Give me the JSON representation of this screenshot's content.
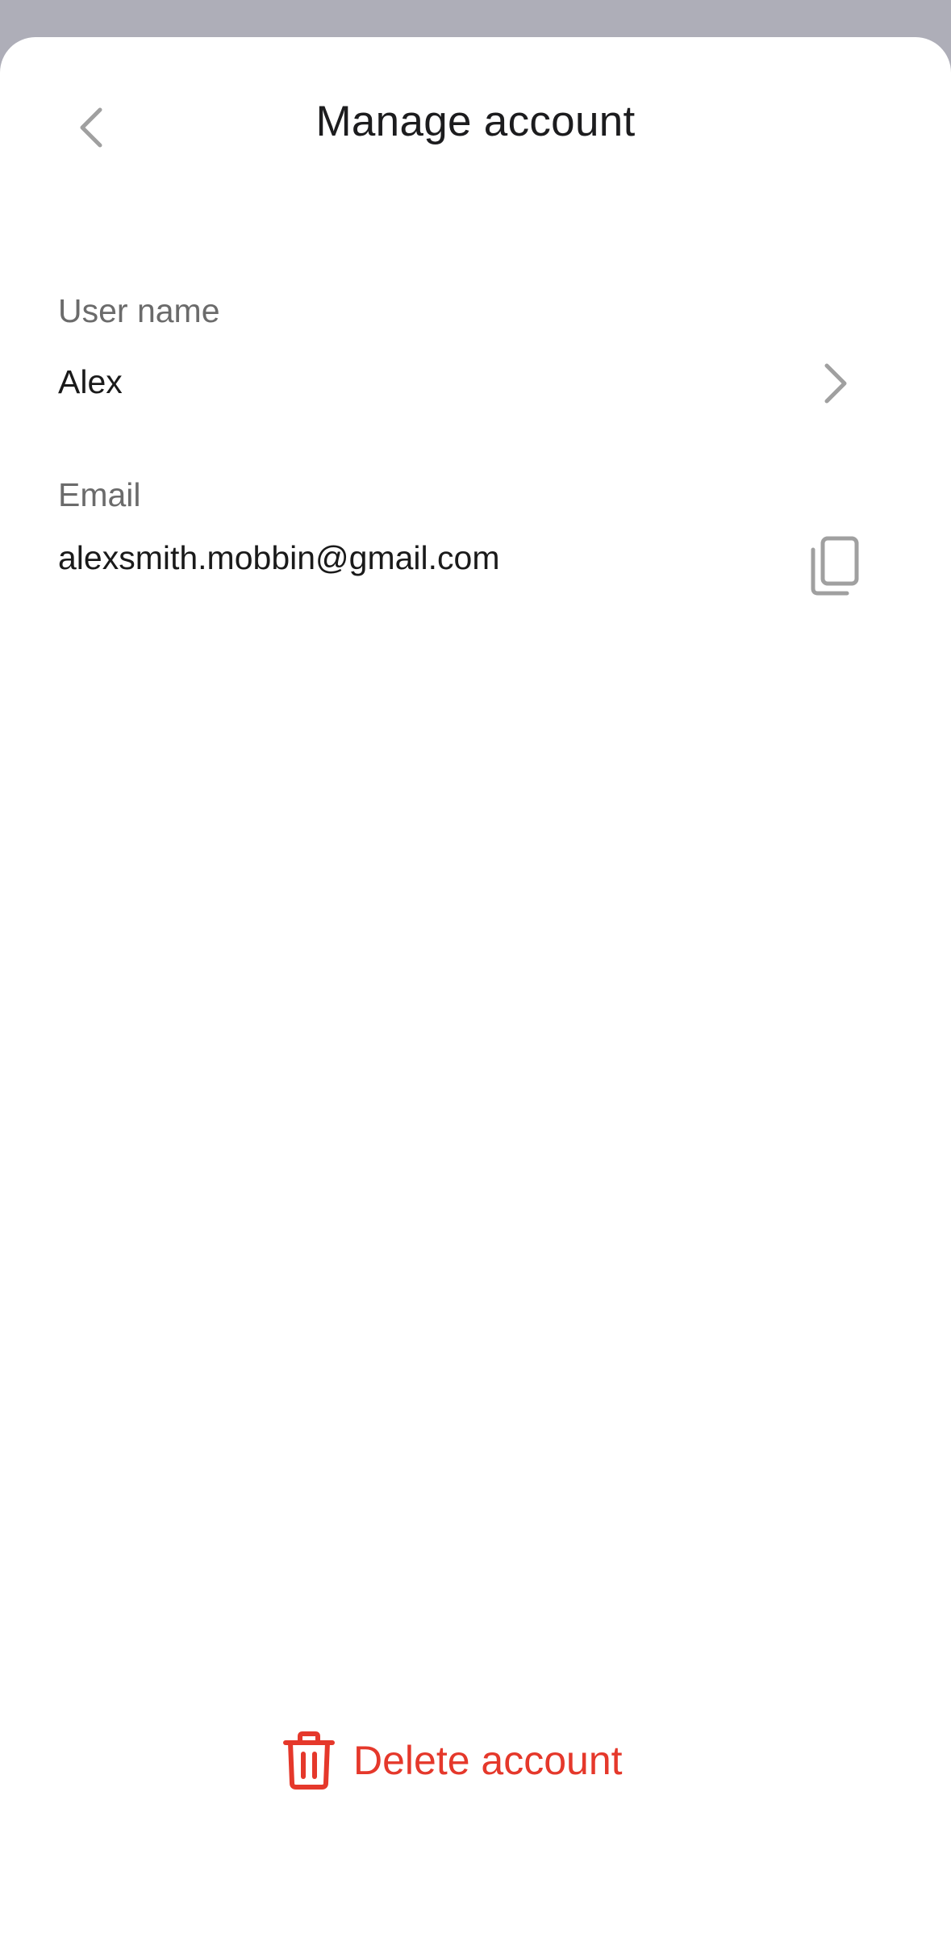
{
  "header": {
    "title": "Manage account"
  },
  "fields": {
    "username": {
      "label": "User name",
      "value": "Alex"
    },
    "email": {
      "label": "Email",
      "value": "alexsmith.mobbin@gmail.com"
    }
  },
  "actions": {
    "delete_label": "Delete account"
  },
  "icons": {
    "back": "chevron-left-icon",
    "username_action": "chevron-right-icon",
    "email_action": "copy-icon",
    "delete": "trash-icon"
  },
  "colors": {
    "danger": "#e5382b",
    "icon_muted": "#a0a0a0",
    "backdrop": "#aeaeb8"
  }
}
